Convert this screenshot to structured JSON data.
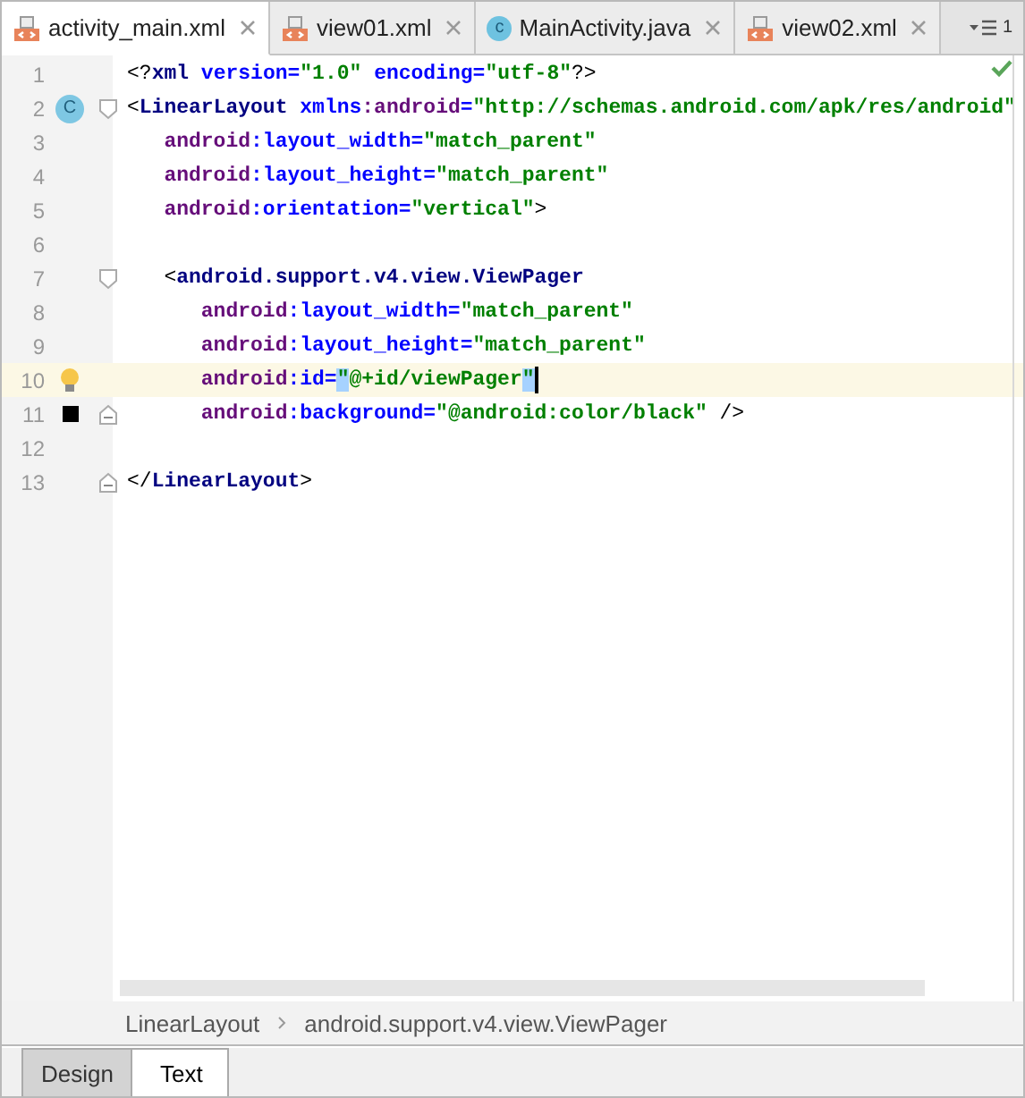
{
  "tabs": [
    {
      "label": "activity_main.xml",
      "kind": "xml",
      "selected": true
    },
    {
      "label": "view01.xml",
      "kind": "xml",
      "selected": false
    },
    {
      "label": "MainActivity.java",
      "kind": "class",
      "icon_letter": "c",
      "selected": false
    },
    {
      "label": "view02.xml",
      "kind": "xml",
      "selected": false
    }
  ],
  "tab_menu": {
    "count": "1"
  },
  "editor": {
    "inspection_ok": true,
    "lines": [
      {
        "number": "1",
        "current": false,
        "tokens": [
          {
            "kind": "punct",
            "text": "<?"
          },
          {
            "kind": "tag",
            "text": "xml"
          },
          {
            "kind": "attr",
            "text": " version="
          },
          {
            "kind": "value",
            "text": "\"1.0\""
          },
          {
            "kind": "attr",
            "text": " encoding="
          },
          {
            "kind": "value",
            "text": "\"utf-8\""
          },
          {
            "kind": "punct",
            "text": "?>"
          }
        ]
      },
      {
        "number": "2",
        "current": false,
        "marker": {
          "kind": "class",
          "letter": "C"
        },
        "fold": {
          "kind": "start"
        },
        "tokens": [
          {
            "kind": "punct",
            "text": "<"
          },
          {
            "kind": "tag",
            "text": "LinearLayout"
          },
          {
            "kind": "attr",
            "text": " xmlns"
          },
          {
            "kind": "ns",
            "text": ":android"
          },
          {
            "kind": "attr",
            "text": "="
          },
          {
            "kind": "value",
            "text": "\"http://schemas.android.com/apk/res/android\""
          }
        ]
      },
      {
        "number": "3",
        "current": false,
        "tokens": [
          {
            "kind": "ns",
            "text": "   android"
          },
          {
            "kind": "attr",
            "text": ":layout_width="
          },
          {
            "kind": "value",
            "text": "\"match_parent\""
          }
        ]
      },
      {
        "number": "4",
        "current": false,
        "tokens": [
          {
            "kind": "ns",
            "text": "   android"
          },
          {
            "kind": "attr",
            "text": ":layout_height="
          },
          {
            "kind": "value",
            "text": "\"match_parent\""
          }
        ]
      },
      {
        "number": "5",
        "current": false,
        "tokens": [
          {
            "kind": "ns",
            "text": "   android"
          },
          {
            "kind": "attr",
            "text": ":orientation="
          },
          {
            "kind": "value",
            "text": "\"vertical\""
          },
          {
            "kind": "punct",
            "text": ">"
          }
        ]
      },
      {
        "number": "6",
        "current": false
      },
      {
        "number": "7",
        "current": false,
        "fold": {
          "kind": "start"
        },
        "tokens": [
          {
            "kind": "punct",
            "text": "   <"
          },
          {
            "kind": "tag",
            "text": "android.support.v4.view.ViewPager"
          }
        ]
      },
      {
        "number": "8",
        "current": false,
        "tokens": [
          {
            "kind": "ns",
            "text": "      android"
          },
          {
            "kind": "attr",
            "text": ":layout_width="
          },
          {
            "kind": "value",
            "text": "\"match_parent\""
          }
        ]
      },
      {
        "number": "9",
        "current": false,
        "tokens": [
          {
            "kind": "ns",
            "text": "      android"
          },
          {
            "kind": "attr",
            "text": ":layout_height="
          },
          {
            "kind": "value",
            "text": "\"match_parent\""
          }
        ]
      },
      {
        "number": "10",
        "current": true,
        "marker": {
          "kind": "bulb"
        },
        "caret": true,
        "tokens": [
          {
            "kind": "ns",
            "text": "      android"
          },
          {
            "kind": "attr",
            "text": ":id="
          },
          {
            "kind": "value",
            "text": "\"",
            "highlighted": true
          },
          {
            "kind": "value",
            "text": "@+id/viewPager"
          },
          {
            "kind": "value",
            "text": "\"",
            "highlighted": true
          }
        ]
      },
      {
        "number": "11",
        "current": false,
        "marker": {
          "kind": "swatch",
          "color": "#000000"
        },
        "fold": {
          "kind": "end"
        },
        "tokens": [
          {
            "kind": "ns",
            "text": "      android"
          },
          {
            "kind": "attr",
            "text": ":background="
          },
          {
            "kind": "value",
            "text": "\"@android:color/black\""
          },
          {
            "kind": "punct",
            "text": " />"
          }
        ]
      },
      {
        "number": "12",
        "current": false
      },
      {
        "number": "13",
        "current": false,
        "fold": {
          "kind": "end"
        },
        "tokens": [
          {
            "kind": "punct",
            "text": "</"
          },
          {
            "kind": "tag",
            "text": "LinearLayout"
          },
          {
            "kind": "punct",
            "text": ">"
          }
        ]
      }
    ]
  },
  "breadcrumbs": [
    "LinearLayout",
    "android.support.v4.view.ViewPager"
  ],
  "bottom_tabs": [
    {
      "label": "Design",
      "selected": false
    },
    {
      "label": "Text",
      "selected": true
    }
  ]
}
